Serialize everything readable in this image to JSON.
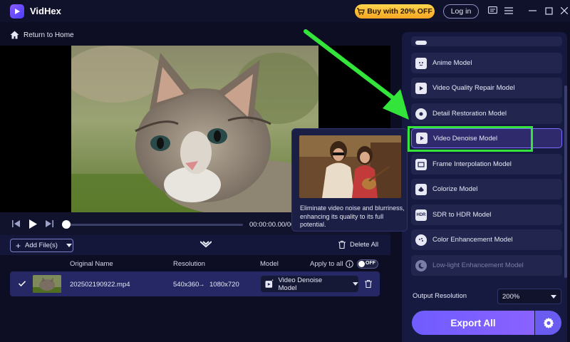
{
  "app": {
    "name": "VidHex"
  },
  "titlebar": {
    "buy_label": "Buy with 20% OFF",
    "login_label": "Log in"
  },
  "nav": {
    "back_label": "Return to Home"
  },
  "player": {
    "time": "00:00:00.00/00:00:10.00"
  },
  "toolbar": {
    "add_files_label": "Add File(s)",
    "delete_all_label": "Delete All"
  },
  "table": {
    "headers": [
      "Original Name",
      "Resolution",
      "Model"
    ],
    "apply_to_all_label": "Apply to all",
    "toggle_state": "OFF",
    "rows": [
      {
        "name": "202502190922.mp4",
        "res_from": "540x360",
        "res_to": "1080x720",
        "model": "Video Denoise Model"
      }
    ]
  },
  "tooltip": {
    "text": "Eliminate video noise and blurriness, enhancing its quality to its full potential."
  },
  "models": {
    "items": [
      "Anime Model",
      "Video Quality Repair Model",
      "Detail Restoration Model",
      "Video Denoise Model",
      "Frame Interpolation Model",
      "Colorize Model",
      "SDR to HDR Model",
      "Color Enhancement Model",
      "Low-light Enhancement Model"
    ],
    "selected": "Video Denoise Model",
    "hdr_icon_text": "HDR"
  },
  "output": {
    "label": "Output Resolution",
    "value": "200%"
  },
  "export": {
    "label": "Export All"
  },
  "colors": {
    "accent": "#6f5cff",
    "annotation": "#33e53a",
    "buy_button": "#f5a623"
  }
}
